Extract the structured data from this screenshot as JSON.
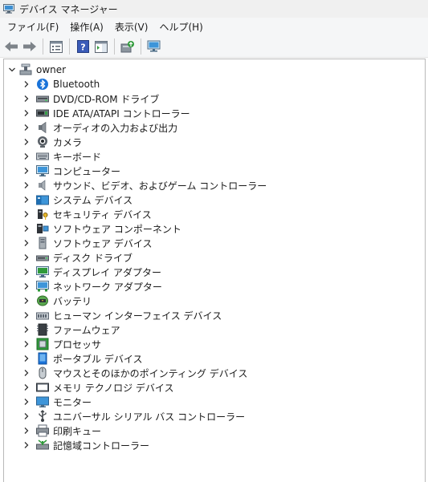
{
  "window": {
    "title": "デバイス マネージャー"
  },
  "menu": [
    "ファイル(F)",
    "操作(A)",
    "表示(V)",
    "ヘルプ(H)"
  ],
  "toolbar": {
    "buttons": [
      "back-arrow-icon",
      "forward-arrow-icon",
      "properties-icon",
      "help-icon",
      "action-pane-icon",
      "update-driver-icon",
      "monitor-scan-icon"
    ]
  },
  "tree": {
    "root": {
      "label": "owner",
      "icon": "computer-icon",
      "expanded": true
    },
    "categories": [
      {
        "label": "Bluetooth",
        "icon": "bluetooth-icon"
      },
      {
        "label": "DVD/CD-ROM ドライブ",
        "icon": "dvd-drive-icon"
      },
      {
        "label": "IDE ATA/ATAPI コントローラー",
        "icon": "ide-controller-icon"
      },
      {
        "label": "オーディオの入力および出力",
        "icon": "speaker-icon"
      },
      {
        "label": "カメラ",
        "icon": "camera-icon"
      },
      {
        "label": "キーボード",
        "icon": "keyboard-icon"
      },
      {
        "label": "コンピューター",
        "icon": "computer-monitor-icon"
      },
      {
        "label": "サウンド、ビデオ、およびゲーム コントローラー",
        "icon": "sound-icon"
      },
      {
        "label": "システム デバイス",
        "icon": "system-devices-icon"
      },
      {
        "label": "セキュリティ デバイス",
        "icon": "security-device-icon"
      },
      {
        "label": "ソフトウェア コンポーネント",
        "icon": "software-component-icon"
      },
      {
        "label": "ソフトウェア デバイス",
        "icon": "software-device-icon"
      },
      {
        "label": "ディスク ドライブ",
        "icon": "disk-drive-icon"
      },
      {
        "label": "ディスプレイ アダプター",
        "icon": "display-adapter-icon"
      },
      {
        "label": "ネットワーク アダプター",
        "icon": "network-adapter-icon"
      },
      {
        "label": "バッテリ",
        "icon": "battery-icon"
      },
      {
        "label": "ヒューマン インターフェイス デバイス",
        "icon": "hid-icon"
      },
      {
        "label": "ファームウェア",
        "icon": "firmware-icon"
      },
      {
        "label": "プロセッサ",
        "icon": "processor-icon"
      },
      {
        "label": "ポータブル デバイス",
        "icon": "portable-device-icon"
      },
      {
        "label": "マウスとそのほかのポインティング デバイス",
        "icon": "mouse-icon"
      },
      {
        "label": "メモリ テクノロジ デバイス",
        "icon": "memory-tech-icon"
      },
      {
        "label": "モニター",
        "icon": "monitor-icon"
      },
      {
        "label": "ユニバーサル シリアル バス コントローラー",
        "icon": "usb-icon"
      },
      {
        "label": "印刷キュー",
        "icon": "printer-icon"
      },
      {
        "label": "記憶域コントローラー",
        "icon": "storage-controller-icon"
      }
    ]
  },
  "colors": {
    "accent": "#1a8fd6",
    "titlebar_bg": "#f0f0f0",
    "menubar_bg": "#f5f6f7"
  }
}
